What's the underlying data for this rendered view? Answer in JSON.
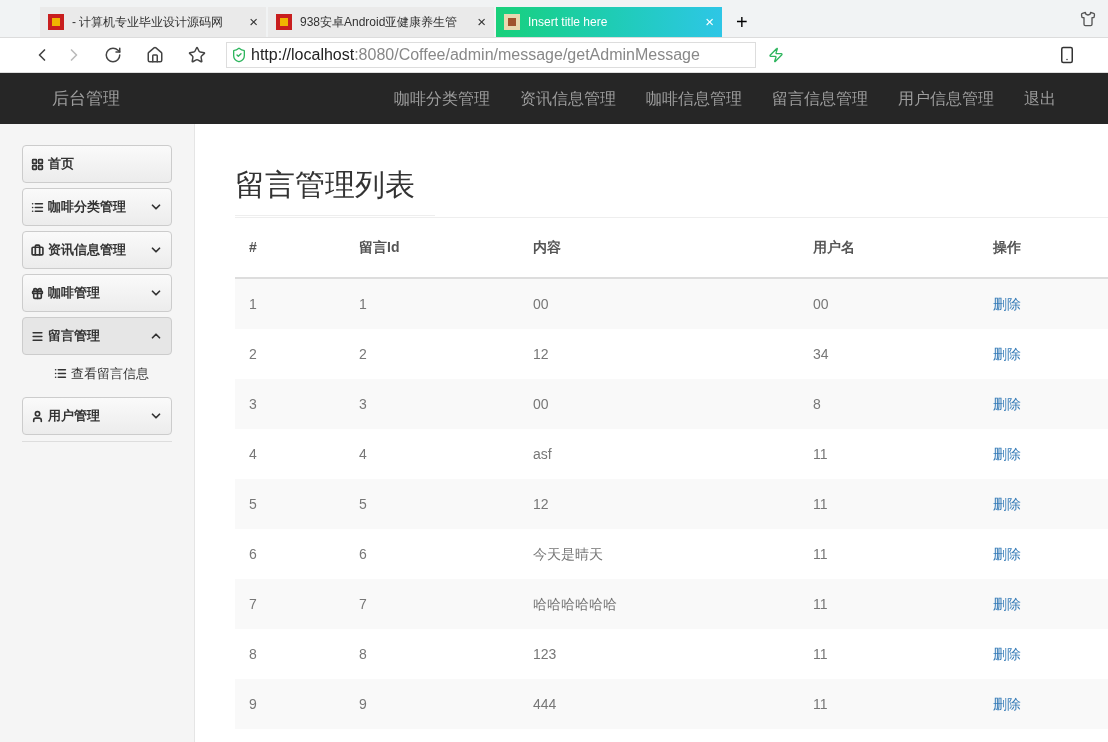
{
  "browser": {
    "tabs": [
      {
        "title": "- 计算机专业毕业设计源码网",
        "selected": false,
        "close": "×"
      },
      {
        "title": "938安卓Android亚健康养生管",
        "selected": false,
        "close": "×"
      },
      {
        "title": "Insert title here",
        "selected": true,
        "close": "×"
      }
    ],
    "new_tab": "+",
    "address": {
      "host": "http://localhost",
      "rest": ":8080/Coffee/admin/message/getAdminMessage"
    }
  },
  "navbar": {
    "brand": "后台管理",
    "items": [
      "咖啡分类管理",
      "资讯信息管理",
      "咖啡信息管理",
      "留言信息管理",
      "用户信息管理",
      "退出"
    ]
  },
  "sidebar": {
    "items": [
      {
        "label": "首页",
        "kind": "link"
      },
      {
        "label": "咖啡分类管理",
        "kind": "menu",
        "expanded": false
      },
      {
        "label": "资讯信息管理",
        "kind": "menu",
        "expanded": false
      },
      {
        "label": "咖啡管理",
        "kind": "menu",
        "expanded": false
      },
      {
        "label": "留言管理",
        "kind": "menu",
        "expanded": true,
        "children": [
          {
            "label": "查看留言信息"
          }
        ]
      },
      {
        "label": "用户管理",
        "kind": "menu",
        "expanded": false
      }
    ]
  },
  "main": {
    "title": "留言管理列表",
    "table": {
      "columns": [
        "#",
        "留言Id",
        "内容",
        "用户名",
        "操作"
      ],
      "rows": [
        {
          "cells": [
            "1",
            "1",
            "00",
            "00"
          ],
          "action": "删除"
        },
        {
          "cells": [
            "2",
            "2",
            "12",
            "34"
          ],
          "action": "删除"
        },
        {
          "cells": [
            "3",
            "3",
            "00",
            "8"
          ],
          "action": "删除"
        },
        {
          "cells": [
            "4",
            "4",
            "asf",
            "11"
          ],
          "action": "删除"
        },
        {
          "cells": [
            "5",
            "5",
            "12",
            "11"
          ],
          "action": "删除"
        },
        {
          "cells": [
            "6",
            "6",
            "今天是晴天",
            "11"
          ],
          "action": "删除"
        },
        {
          "cells": [
            "7",
            "7",
            "哈哈哈哈哈哈",
            "11"
          ],
          "action": "删除"
        },
        {
          "cells": [
            "8",
            "8",
            "123",
            "11"
          ],
          "action": "删除"
        },
        {
          "cells": [
            "9",
            "9",
            "444",
            "11"
          ],
          "action": "删除"
        }
      ]
    }
  }
}
